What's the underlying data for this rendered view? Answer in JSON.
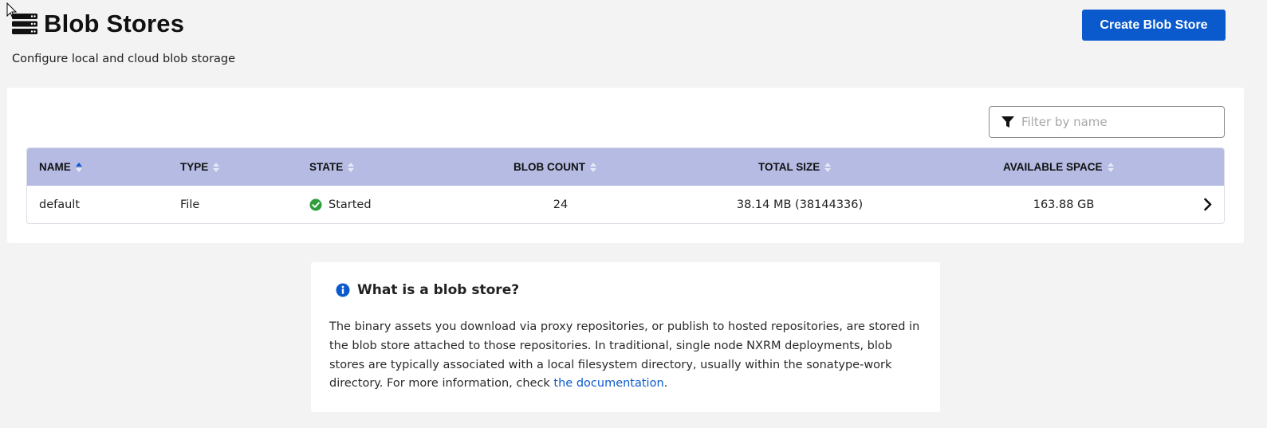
{
  "header": {
    "title": "Blob Stores",
    "subtitle": "Configure local and cloud blob storage",
    "create_button_label": "Create Blob Store",
    "icon": "server-stack-icon"
  },
  "filter": {
    "placeholder": "Filter by name",
    "value": "",
    "icon": "filter-funnel-icon"
  },
  "table": {
    "columns": [
      {
        "label": "NAME",
        "sort": "ascending"
      },
      {
        "label": "TYPE",
        "sort": "none"
      },
      {
        "label": "STATE",
        "sort": "none"
      },
      {
        "label": "BLOB COUNT",
        "sort": "none"
      },
      {
        "label": "TOTAL SIZE",
        "sort": "none"
      },
      {
        "label": "AVAILABLE SPACE",
        "sort": "none"
      }
    ],
    "rows": [
      {
        "name": "default",
        "type": "File",
        "state": "Started",
        "blob_count": "24",
        "total_size": "38.14 MB (38144336)",
        "available_space": "163.88 GB"
      }
    ]
  },
  "info": {
    "title": "What is a blob store?",
    "body": "The binary assets you download via proxy repositories, or publish to hosted repositories, are stored in the blob store attached to those repositories. In traditional, single node NXRM deployments, blob stores are typically associated with a local filesystem directory, usually within the sonatype-work directory. For more information, check ",
    "link_text": "the documentation",
    "trailing": "."
  },
  "colors": {
    "accent": "#0b5acd",
    "table_header": "#b5bbe2",
    "status_ok": "#2e9d3a",
    "background": "#f3f3f3"
  }
}
